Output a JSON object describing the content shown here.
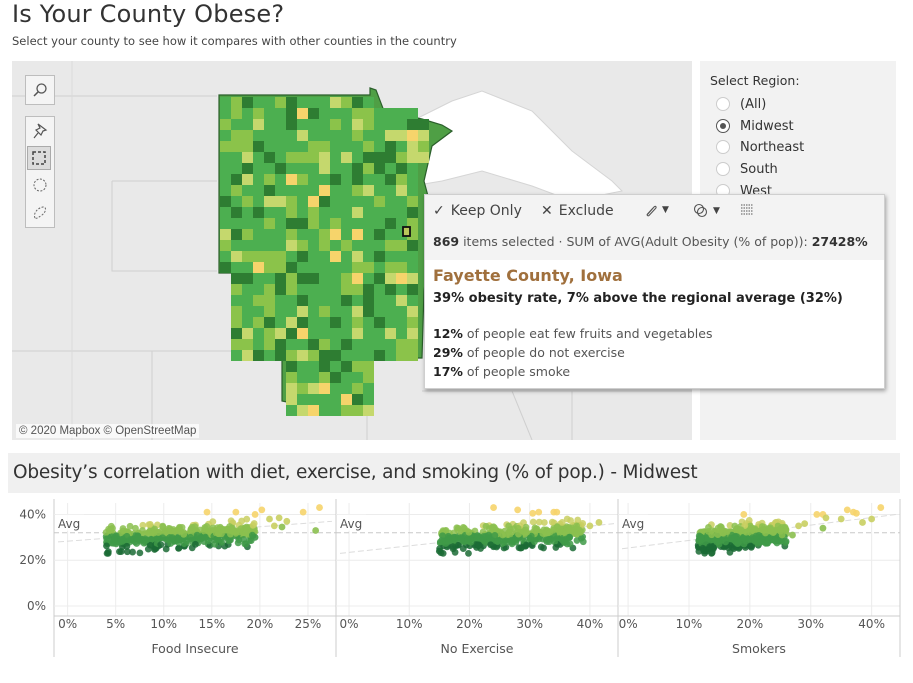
{
  "header": {
    "title": "Is Your County Obese?",
    "subtitle": "Select your county to see how it compares with other counties in the country"
  },
  "map": {
    "attribution": "© 2020 Mapbox © OpenStreetMap",
    "tools": [
      "search-icon",
      "pin-icon",
      "rectangle-select-icon",
      "radial-select-icon",
      "lasso-select-icon"
    ],
    "active_tool": "rectangle-select-icon",
    "colors": {
      "dark": "#2e7d32",
      "mid": "#4caf50",
      "light": "#8bc34a",
      "pale": "#c5d86d",
      "yellow": "#f6d46b",
      "basemap": "#e9e9e9",
      "water": "#ffffff"
    }
  },
  "region_filter": {
    "label": "Select Region:",
    "options": [
      "(All)",
      "Midwest",
      "Northeast",
      "South",
      "West"
    ],
    "selected": "Midwest"
  },
  "tooltip": {
    "actions": {
      "keep_only": "Keep Only",
      "exclude": "Exclude",
      "group_icon": "paperclip-icon",
      "set_icon": "set-icon",
      "view_data_icon": "view-data-icon"
    },
    "summary": {
      "count": "869",
      "count_suffix": " items selected",
      "separator": " · ",
      "measure": "SUM of AVG(Adult Obesity (% of pop)): ",
      "measure_value": "27428%"
    },
    "county": "Fayette County, Iowa",
    "rate_line": "39% obesity rate, 7% above the regional average (32%)",
    "stats": [
      {
        "value": "12%",
        "text": " of people eat few fruits and vegetables"
      },
      {
        "value": "29%",
        "text": " of people do not exercise"
      },
      {
        "value": "17%",
        "text": " of people smoke"
      }
    ],
    "title_color": "#a0703d"
  },
  "correlation": {
    "title": "Obesity’s correlation with diet, exercise, and smoking (% of pop.) - Midwest"
  },
  "chart_data": {
    "type": "scatter",
    "title": "Obesity’s correlation with diet, exercise, and smoking (% of pop.) - Midwest",
    "ylabel": "Adult Obesity (% of pop)",
    "ylim": [
      0,
      45
    ],
    "y_ticks": [
      "0%",
      "20%",
      "40%"
    ],
    "reference_line": {
      "label": "Avg",
      "value": 32
    },
    "grid": true,
    "color_scale": [
      "#1b6b35",
      "#3f9a48",
      "#8bbf4f",
      "#c9cf62",
      "#f6d46b"
    ],
    "panels": [
      {
        "name": "Food Insecure",
        "xlim": [
          -1,
          27.5
        ],
        "x_ticks": [
          0,
          5,
          10,
          15,
          20,
          25
        ],
        "x_tick_labels": [
          "0%",
          "5%",
          "10%",
          "15%",
          "20%",
          "25%"
        ],
        "cluster": {
          "x_min": 4,
          "x_max": 19.5,
          "y_min": 23,
          "y_max": 38,
          "n": 420
        },
        "trend": [
          [
            -1,
            28
          ],
          [
            27.5,
            37
          ]
        ],
        "outliers": [
          [
            14.5,
            41
          ],
          [
            17.5,
            41
          ],
          [
            19.5,
            40
          ],
          [
            20.2,
            42
          ],
          [
            24.5,
            41
          ],
          [
            26.2,
            43
          ],
          [
            21,
            38
          ],
          [
            22,
            38.5
          ],
          [
            22.8,
            37
          ],
          [
            25.8,
            33
          ],
          [
            19.5,
            30
          ],
          [
            21.5,
            35
          ],
          [
            22.3,
            34.5
          ]
        ]
      },
      {
        "name": "No Exercise",
        "xlim": [
          -1.5,
          44
        ],
        "x_ticks": [
          0,
          10,
          20,
          30,
          40
        ],
        "x_tick_labels": [
          "0%",
          "10%",
          "20%",
          "30%",
          "40%"
        ],
        "cluster": {
          "x_min": 15,
          "x_max": 39,
          "y_min": 23,
          "y_max": 38,
          "n": 420
        },
        "trend": [
          [
            -1.5,
            23
          ],
          [
            44,
            36
          ]
        ],
        "outliers": [
          [
            24,
            43
          ],
          [
            28,
            42
          ],
          [
            30.5,
            40.5
          ],
          [
            31.5,
            41
          ],
          [
            34,
            41
          ],
          [
            34.5,
            41
          ],
          [
            40,
            35
          ],
          [
            41.5,
            36.5
          ],
          [
            15,
            24
          ]
        ]
      },
      {
        "name": "Smokers",
        "xlim": [
          -1,
          44
        ],
        "x_ticks": [
          0,
          10,
          20,
          30,
          40
        ],
        "x_tick_labels": [
          "0%",
          "10%",
          "20%",
          "30%",
          "40%"
        ],
        "cluster": {
          "x_min": 11.5,
          "x_max": 26,
          "y_min": 23,
          "y_max": 38,
          "n": 420
        },
        "trend": [
          [
            -1,
            25
          ],
          [
            44,
            40
          ]
        ],
        "outliers": [
          [
            19,
            40
          ],
          [
            31,
            40
          ],
          [
            32,
            40
          ],
          [
            32.5,
            38.5
          ],
          [
            36,
            42
          ],
          [
            37,
            41
          ],
          [
            37.5,
            40.5
          ],
          [
            38.5,
            36.5
          ],
          [
            40,
            38
          ],
          [
            41.5,
            43
          ],
          [
            29,
            36
          ],
          [
            28,
            35
          ],
          [
            32,
            34
          ],
          [
            35,
            38
          ],
          [
            27,
            31
          ]
        ]
      }
    ]
  }
}
